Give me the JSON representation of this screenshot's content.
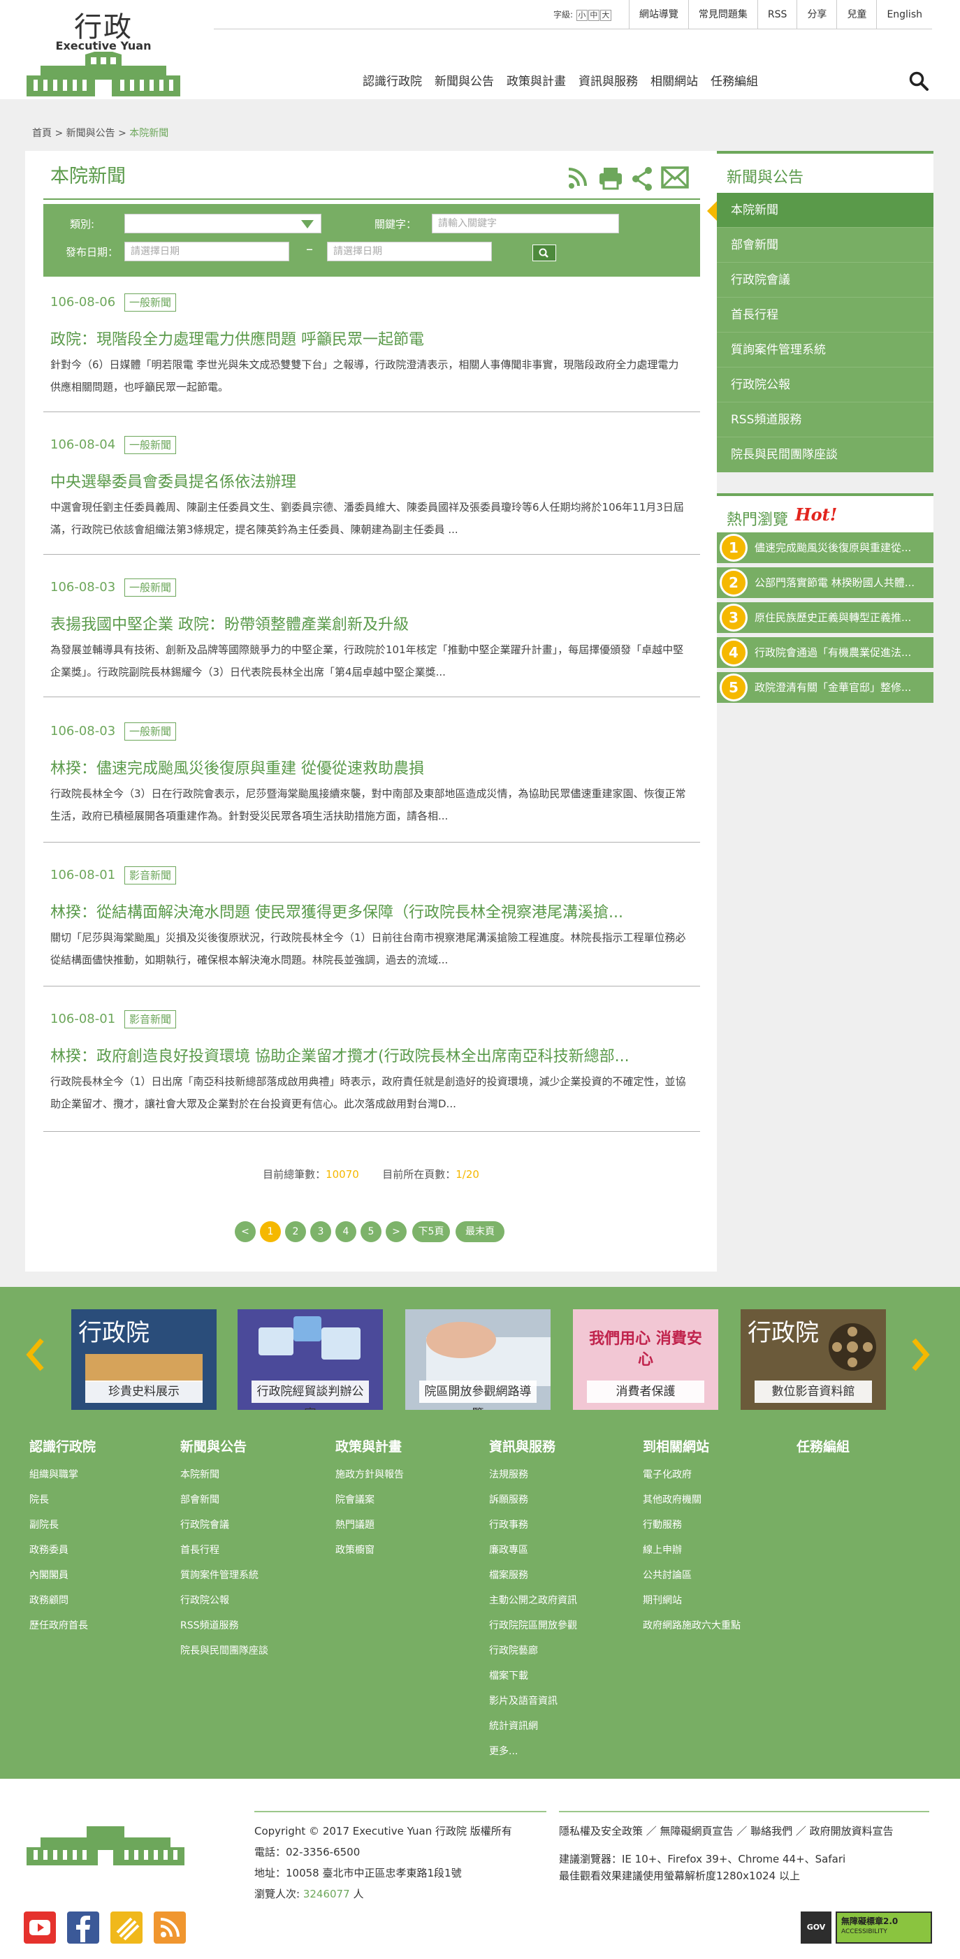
{
  "header": {
    "logo_cn": "行政院",
    "logo_en": "Executive Yuan",
    "font_size_label": "字級:",
    "font_sizes": [
      "小",
      "中",
      "大"
    ],
    "top_links": [
      "網站導覽",
      "常見問題集",
      "RSS",
      "分享",
      "兒童",
      "English"
    ],
    "nav": [
      "認識行政院",
      "新聞與公告",
      "政策與計畫",
      "資訊與服務",
      "相關網站",
      "任務編組"
    ]
  },
  "breadcrumb": {
    "home": "首頁",
    "sep": ">",
    "section": "新聞與公告",
    "current": "本院新聞"
  },
  "page_title": "本院新聞",
  "filter": {
    "category_label": "類別:",
    "keyword_label": "關鍵字：",
    "keyword_placeholder": "請輸入關鍵字",
    "date_label": "發布日期：",
    "date_placeholder": "請選擇日期",
    "date_sep": "–"
  },
  "news": [
    {
      "date": "106-08-06",
      "tag": "一般新聞",
      "title": "政院：現階段全力處理電力供應問題 呼籲民眾一起節電",
      "desc": "針對今（6）日媒體「明若限電 李世光與朱文成恐雙雙下台」之報導，行政院澄清表示，相關人事傳聞非事實，現階段政府全力處理電力供應相關問題，也呼籲民眾一起節電。"
    },
    {
      "date": "106-08-04",
      "tag": "一般新聞",
      "title": "中央選舉委員會委員提名係依法辦理",
      "desc": "中選會現任劉主任委員義周、陳副主任委員文生、劉委員宗德、潘委員維大、陳委員國祥及張委員瓊玲等6人任期均將於106年11月3日屆滿，行政院已依該會組織法第3條規定，提名陳英鈐為主任委員、陳朝建為副主任委員 ..."
    },
    {
      "date": "106-08-03",
      "tag": "一般新聞",
      "title": "表揚我國中堅企業 政院：盼帶領整體產業創新及升級",
      "desc": "為發展並輔導具有技術、創新及品牌等國際競爭力的中堅企業，行政院於101年核定「推動中堅企業躍升計畫」，每屆擇優頒發「卓越中堅企業獎」。行政院副院長林錫耀今（3）日代表院長林全出席「第4屆卓越中堅企業獎..."
    },
    {
      "date": "106-08-03",
      "tag": "一般新聞",
      "title": "林揆：儘速完成颱風災後復原與重建 從優從速救助農損",
      "desc": "行政院長林全今（3）日在行政院會表示，尼莎暨海棠颱風接續來襲，對中南部及東部地區造成災情，為協助民眾儘速重建家園、恢復正常生活，政府已積極展開各項重建作為。針對受災民眾各項生活扶助措施方面，請各相..."
    },
    {
      "date": "106-08-01",
      "tag": "影音新聞",
      "title": "林揆：從結構面解決淹水問題 使民眾獲得更多保障（行政院長林全視察港尾溝溪搶...",
      "desc": "關切「尼莎與海棠颱風」災損及災後復原狀況，行政院長林全今（1）日前往台南市視察港尾溝溪搶險工程進度。林院長指示工程單位務必從結構面儘快推動，如期執行，確保根本解決淹水問題。林院長並強調，過去的流域..."
    },
    {
      "date": "106-08-01",
      "tag": "影音新聞",
      "title": "林揆：政府創造良好投資環境 協助企業留才攬才(行政院長林全出席南亞科技新總部...",
      "desc": "行政院長林全今（1）日出席「南亞科技新總部落成啟用典禮」時表示，政府責任就是創造好的投資環境，減少企業投資的不確定性，並協助企業留才、攬才，讓社會大眾及企業對於在台投資更有信心。此次落成啟用對台灣D..."
    }
  ],
  "stats": {
    "total_label": "目前總筆數：",
    "total": "10070",
    "page_label": "目前所在頁數：",
    "page": "1/20"
  },
  "pager": {
    "prev": "<",
    "pages": [
      "1",
      "2",
      "3",
      "4",
      "5"
    ],
    "next": ">",
    "next_page": "下5頁",
    "last": "最末頁"
  },
  "sidebar": {
    "title": "新聞與公告",
    "items": [
      "本院新聞",
      "部會新聞",
      "行政院會議",
      "首長行程",
      "質詢案件管理系統",
      "行政院公報",
      "RSS頻道服務",
      "院長與民間團隊座談"
    ]
  },
  "hot": {
    "title": "熱門瀏覽",
    "badge": "Hot!",
    "items": [
      "儘速完成颱風災後復原與重建從...",
      "公部門落實節電 林揆盼國人共體...",
      "原住民族歷史正義與轉型正義推...",
      "行政院會通過「有機農業促進法...",
      "政院澄清有關「金華官邸」整修..."
    ]
  },
  "banners": [
    {
      "label": "珍貴史料展示",
      "logo": "行政院",
      "color": "#2a4d7a"
    },
    {
      "label": "行政院經貿談判辦公室",
      "logo": "",
      "color": "#4b4a9a"
    },
    {
      "label": "院區開放參觀網路導覽",
      "logo": "",
      "color": "#b9c6d2"
    },
    {
      "label": "消費者保護",
      "logo": "我們用心 消費安心",
      "color": "#f2c7d4"
    },
    {
      "label": "數位影音資料館",
      "logo": "行政院",
      "color": "#6b5a3a"
    }
  ],
  "footer_cols": [
    {
      "title": "認識行政院",
      "items": [
        "組織與職掌",
        "院長",
        "副院長",
        "政務委員",
        "內閣閣員",
        "政務顧問",
        "歷任政府首長"
      ]
    },
    {
      "title": "新聞與公告",
      "items": [
        "本院新聞",
        "部會新聞",
        "行政院會議",
        "首長行程",
        "質詢案件管理系統",
        "行政院公報",
        "RSS頻道服務",
        "院長與民間團隊座談"
      ]
    },
    {
      "title": "政策與計畫",
      "items": [
        "施政方針與報告",
        "院會議案",
        "熱門議題",
        "政策櫥窗"
      ]
    },
    {
      "title": "資訊與服務",
      "items": [
        "法規服務",
        "訴願服務",
        "行政事務",
        "廉政專區",
        "檔案服務",
        "主動公開之政府資訊",
        "行政院院區開放參觀",
        "行政院藝廊",
        "檔案下載",
        "影片及語音資訊",
        "統計資訊網",
        "更多..."
      ]
    },
    {
      "title": "到相關網站",
      "items": [
        "電子化政府",
        "其他政府機關",
        "行動服務",
        "線上申辦",
        "公共討論區",
        "期刊網站",
        "政府網路施政六大重點"
      ]
    },
    {
      "title": "任務編組",
      "items": []
    }
  ],
  "bottom": {
    "copyright": "Copyright © 2017 Executive Yuan 行政院 版權所有",
    "phone": "電話：02-3356-6500",
    "address": "地址：10058 臺北市中正區忠孝東路1段1號",
    "visits_label": "瀏覽人次:",
    "visits": "3246077",
    "visits_unit": "人",
    "links": "隱私權及安全政策 ／ 無障礙網頁宣告 ／ 聯絡我們 ／ 政府開放資料宣告",
    "browser": "建議瀏覽器：IE 10+、Firefox 39+、Chrome 44+、Safari",
    "resolution": "最佳觀看效果建議使用螢幕解析度1280x1024 以上",
    "badge": "無障礙標章2.0",
    "badge_sub": "ACCESSIBILITY",
    "gov": "GOV"
  },
  "colors": {
    "green": "#78ae64",
    "dark_green": "#5a9a4a",
    "yellow": "#f5b800"
  }
}
